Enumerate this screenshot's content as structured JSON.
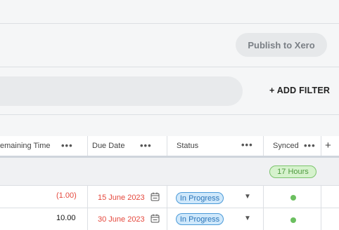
{
  "toolbar": {
    "publish_label": "Publish to Xero"
  },
  "filter": {
    "add_filter_label": "+ ADD FILTER"
  },
  "columns": {
    "remaining_time": "emaining Time",
    "due_date": "Due Date",
    "status": "Status",
    "synced": "Synced",
    "menu_dots": "•••",
    "add_column": "+"
  },
  "group": {
    "hours_badge": "17 Hours"
  },
  "rows": [
    {
      "remaining": "(1.00)",
      "due_date": "15 June 2023",
      "status": "In Progress",
      "synced_color": "#6bbf5f"
    },
    {
      "remaining": "10.00",
      "due_date": "30 June 2023",
      "status": "In Progress",
      "synced_color": "#6bbf5f"
    }
  ],
  "colors": {
    "negative": "#e5483d",
    "date_red": "#e5483d",
    "pill_bg": "#cfe8fb",
    "badge_bg": "#d6f2cd"
  },
  "icons": {
    "calendar": "calendar-icon",
    "caret": "caret-down-icon",
    "synced": "synced-status-dot"
  }
}
